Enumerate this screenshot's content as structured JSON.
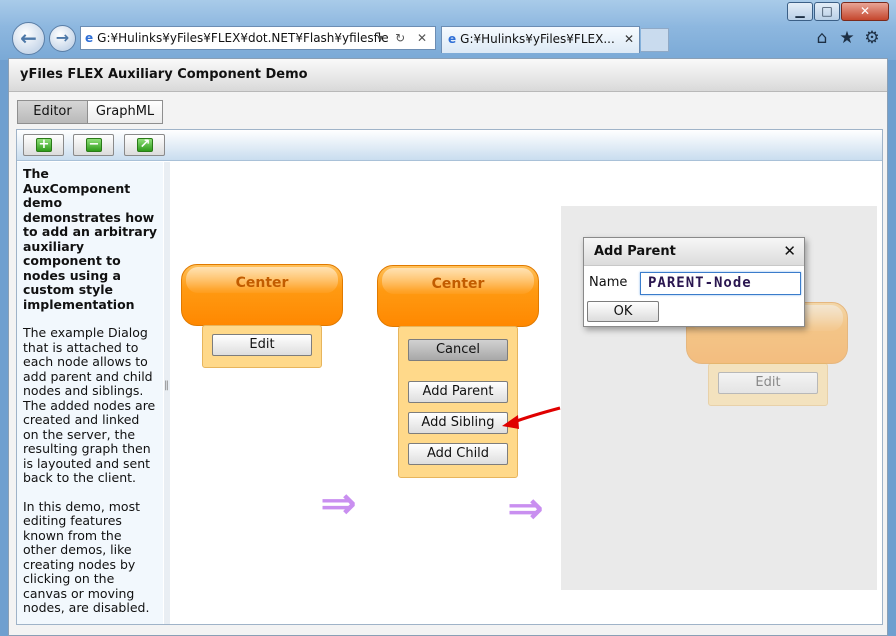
{
  "browser": {
    "window_buttons": {
      "minimize": "▁",
      "maximize": "□",
      "close": "✕"
    },
    "address": "G:¥Hulinks¥yFiles¥FLEX¥dot.NET¥Flash¥yfilesfle",
    "address_actions": "▾ ↻ ✕",
    "tab_title": "G:¥Hulinks¥yFiles¥FLEX...",
    "tab_close": "✕",
    "icons": [
      "back-icon",
      "forward-icon",
      "home-icon",
      "star-icon",
      "gear-icon"
    ]
  },
  "app": {
    "title": "yFiles FLEX Auxiliary Component Demo",
    "tabs": [
      "Editor",
      "GraphML"
    ],
    "toolbar": [
      "add-icon",
      "remove-icon",
      "fit-icon"
    ]
  },
  "description": {
    "lead": "The AuxComponent demo demonstrates how to add an arbitrary auxiliary component to nodes using a custom style implementation",
    "p2": "The example Dialog that is attached to each node allows to add parent and child nodes and siblings. The added nodes are created and linked on the server, the resulting graph then is layouted and sent back to the client.",
    "p3": "In this demo, most editing features known from the other demos, like creating nodes by clicking on the canvas or moving nodes, are disabled."
  },
  "nodes": [
    {
      "label": "Center",
      "buttons": [
        "Edit"
      ]
    },
    {
      "label": "Center",
      "buttons": [
        "Cancel",
        "Add Parent",
        "Add Sibling",
        "Add Child"
      ]
    },
    {
      "label": "",
      "buttons": [
        "Edit"
      ]
    }
  ],
  "dialog": {
    "title": "Add Parent",
    "close": "✕",
    "name_label": "Name",
    "name_value": "PARENT-Node",
    "ok": "OK"
  },
  "colors": {
    "node_orange": "#ff8800",
    "aux_yellow": "#ffd98a",
    "arrow_purple": "#c98ff0",
    "pointer_red": "#e00000"
  }
}
